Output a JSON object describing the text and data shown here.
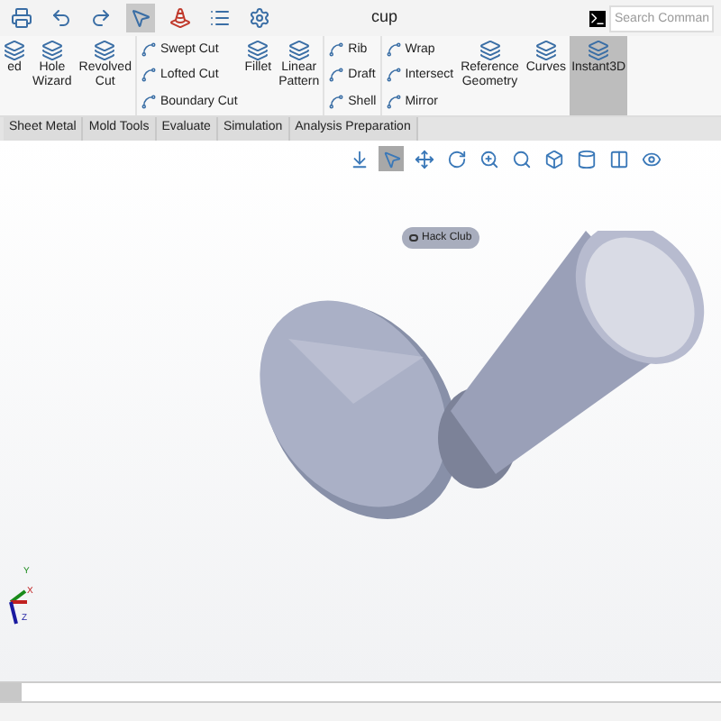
{
  "quick_access": [
    {
      "kind": "print",
      "selected": false
    },
    {
      "kind": "undo",
      "selected": false
    },
    {
      "kind": "redo",
      "selected": false
    },
    {
      "kind": "pointer",
      "selected": true
    },
    {
      "kind": "traffic",
      "selected": false
    },
    {
      "kind": "list",
      "selected": false
    },
    {
      "kind": "gear",
      "selected": false
    }
  ],
  "window": {
    "title": "cup"
  },
  "search": {
    "placeholder": "Search Comman"
  },
  "ribbon": [
    {
      "kind": "large",
      "label": "ed",
      "selected": false
    },
    {
      "kind": "large",
      "label": "Hole\nWizard",
      "selected": false
    },
    {
      "kind": "large",
      "label": "Revolved\nCut",
      "selected": false
    },
    {
      "kind": "stack",
      "items": [
        "Swept Cut",
        "Lofted Cut",
        "Boundary Cut"
      ]
    },
    {
      "kind": "large",
      "label": "Fillet",
      "selected": false
    },
    {
      "kind": "large",
      "label": "Linear\nPattern",
      "selected": false
    },
    {
      "kind": "stack",
      "items": [
        "Rib",
        "Draft",
        "Shell"
      ]
    },
    {
      "kind": "stack",
      "items": [
        "Wrap",
        "Intersect",
        "Mirror"
      ]
    },
    {
      "kind": "large",
      "label": "Reference\nGeometry",
      "selected": false
    },
    {
      "kind": "large",
      "label": "Curves",
      "selected": false
    },
    {
      "kind": "large",
      "label": "Instant3D",
      "selected": true
    }
  ],
  "tabs": [
    {
      "label": "Sheet Metal",
      "selected": false
    },
    {
      "label": "Mold Tools",
      "selected": false
    },
    {
      "label": "Evaluate",
      "selected": false
    },
    {
      "label": "Simulation",
      "selected": false
    },
    {
      "label": "Analysis Preparation",
      "selected": false
    }
  ],
  "view_toolbar": [
    {
      "kind": "normal",
      "selected": false
    },
    {
      "kind": "pointer",
      "selected": true
    },
    {
      "kind": "move",
      "selected": false
    },
    {
      "kind": "rotate",
      "selected": false
    },
    {
      "kind": "zoom",
      "selected": false
    },
    {
      "kind": "zoom-area",
      "selected": false
    },
    {
      "kind": "cube",
      "selected": false
    },
    {
      "kind": "display",
      "selected": false
    },
    {
      "kind": "section",
      "selected": false
    },
    {
      "kind": "eye",
      "selected": false
    }
  ],
  "model": {
    "engraving": "Hack Club"
  },
  "triad": {
    "y": "Y",
    "x": "X",
    "z": "Z"
  }
}
